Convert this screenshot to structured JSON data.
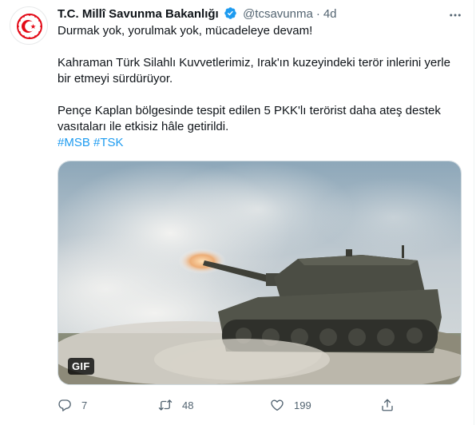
{
  "account": {
    "display_name": "T.C. Millî Savunma Bakanlığı",
    "handle": "@tcsavunma",
    "separator": "·",
    "time": "4d",
    "verified": true
  },
  "tweet": {
    "line1": "Durmak yok, yorulmak yok, mücadeleye devam!",
    "line2": "Kahraman Türk Silahlı Kuvvetlerimiz, Irak'ın kuzeyindeki terör inlerini yerle bir etmeyi sürdürüyor.",
    "line3": "Pençe Kaplan bölgesinde tespit edilen 5 PKK'lı terörist daha ateş destek vasıtaları ile etkisiz hâle getirildi.",
    "hashtags": [
      "#MSB",
      "#TSK"
    ]
  },
  "media": {
    "badge": "GIF"
  },
  "actions": {
    "reply_count": "7",
    "retweet_count": "48",
    "like_count": "199"
  },
  "colors": {
    "accent": "#1d9bf0",
    "muted": "#536471",
    "text": "#0f1419",
    "emblem_red": "#e30a17"
  },
  "icons": [
    "verified-icon",
    "more-icon",
    "reply-icon",
    "retweet-icon",
    "like-icon",
    "share-icon",
    "msb-emblem-icon"
  ]
}
